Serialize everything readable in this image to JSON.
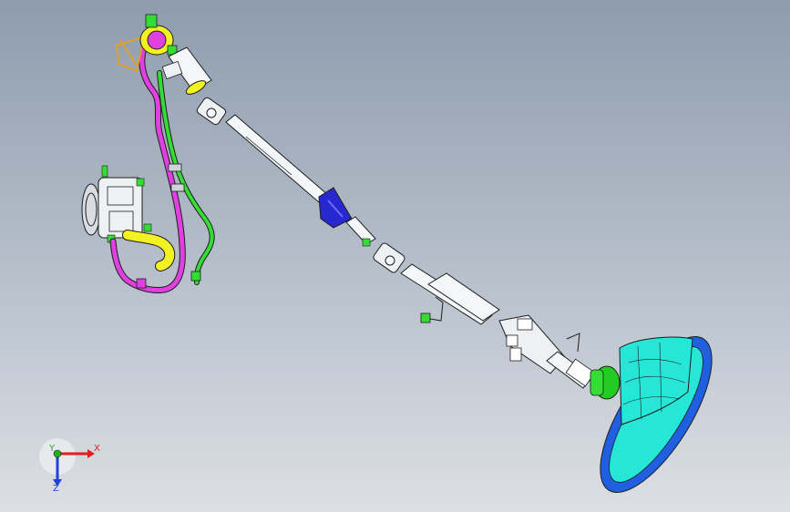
{
  "triad": {
    "x_label": "X",
    "y_label": "Y",
    "z_label": "Z"
  },
  "colors": {
    "background_top": "#8e9cae",
    "background_bottom": "#dcdfe4",
    "shaft": "#f4f6f8",
    "outline": "#1e1e1e",
    "pipe_magenta": "#e040e0",
    "pipe_green": "#33dd33",
    "pipe_yellow": "#f2f222",
    "joint_blue": "#2828d0",
    "wheel_cyan": "#26e6d8",
    "wheel_rim": "#2060e0",
    "hub_green": "#22cc22",
    "axis_x": "#e02020",
    "axis_y": "#20b020",
    "axis_z": "#2040e0"
  }
}
